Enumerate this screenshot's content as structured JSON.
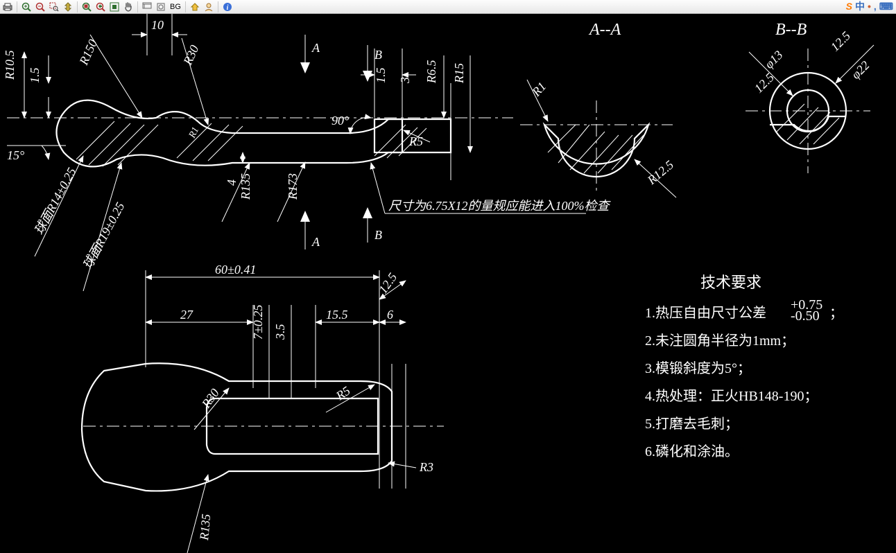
{
  "toolbar": {
    "print": "print-icon",
    "zoom_in": "zoom-in-icon",
    "zoom_out": "zoom-out-icon",
    "zoom_window": "zoom-window-icon",
    "zoom_dyn": "zoom-dynamic-icon",
    "zoom_ext": "zoom-extents-icon",
    "zoom_prev": "zoom-previous-icon",
    "zoom_all": "zoom-all-icon",
    "pan": "pan-icon",
    "redraw": "redraw-icon",
    "draw": "draw-icon",
    "bg_label": "BG",
    "home": "home-icon",
    "user": "user-icon",
    "info": "info-icon"
  },
  "corner": {
    "logo": "S",
    "frag1": "中",
    "frag2": ",",
    "icon_kb": "⌨"
  },
  "sections": {
    "aa": "A--A",
    "bb": "B--B",
    "a_top": "A",
    "a_bot": "A",
    "b_top": "B",
    "b_bot": "B"
  },
  "dims_top": {
    "d10": "10",
    "r10_5": "R10.5",
    "d1_5a": "1.5",
    "r150": "R150",
    "r30": "R30",
    "ang15": "15°",
    "ang90": "90°",
    "d1_5b": "1.5",
    "d3": "3",
    "r6_5": "R6.5",
    "r15": "R15",
    "r5": "R5",
    "r1_rot": "R1",
    "d4": "4",
    "r135a": "R135",
    "r173": "R173",
    "sphere14": "球面R14±0.25",
    "sphere19": "球面R19±0.25",
    "note_gauge": "尺寸为6.75X12的量规应能进入100%检查"
  },
  "dims_sec_a": {
    "r1": "R1",
    "r12_5": "R12.5"
  },
  "dims_sec_b": {
    "phi13": "φ13",
    "d12_5a": "12.5",
    "d12_5b": "12.5",
    "phi22": "φ22"
  },
  "dims_bottom": {
    "d60": "60±0.41",
    "d12_5": "12.5",
    "d27": "27",
    "d7": "7±0.25",
    "d3_5": "3.5",
    "d15_5": "15.5",
    "d6": "6",
    "r30": "R30",
    "r5": "R5",
    "r3": "R3",
    "r135": "R135"
  },
  "tech_req": {
    "title": "技术要求",
    "line1_a": "1.热压自由尺寸公差",
    "line1_tol_top": "+0.75",
    "line1_tol_bot": "-0.50",
    "line1_b": "；",
    "line2": "2.未注圆角半径为1mm；",
    "line3": "3.模锻斜度为5°；",
    "line4": "4.热处理：正火HB148-190；",
    "line5": "5.打磨去毛刺；",
    "line6": "6.磷化和涂油。"
  }
}
